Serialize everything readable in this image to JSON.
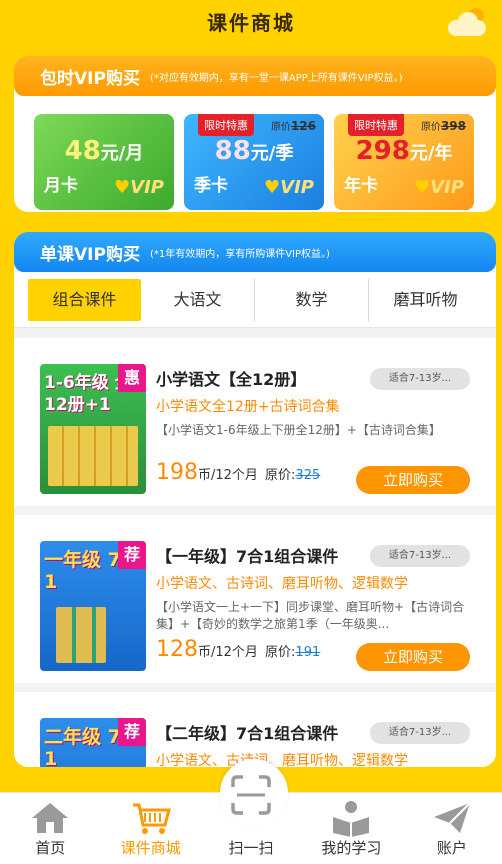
{
  "header": {
    "title": "课件商城"
  },
  "vip": {
    "title": "包时VIP购买",
    "note": "(*对应有效期内，享有一堂一课APP上所有课件VIP权益。)",
    "cards": [
      {
        "price": "48",
        "unit": "元/月",
        "kind": "月卡",
        "tag": "",
        "orig_label": "",
        "orig": ""
      },
      {
        "price": "88",
        "unit": "元/季",
        "kind": "季卡",
        "tag": "限时特惠",
        "orig_label": "原价",
        "orig": "126"
      },
      {
        "price": "298",
        "unit": "元/年",
        "kind": "年卡",
        "tag": "限时特惠",
        "orig_label": "原价",
        "orig": "398"
      }
    ],
    "vip_word": "VIP"
  },
  "single": {
    "title": "单课VIP购买",
    "note": "(*1年有效期内，享有所购课件VIP权益。)"
  },
  "tabs": [
    "组合课件",
    "大语文",
    "数学",
    "磨耳听物"
  ],
  "courses": [
    {
      "cover_text": "1-6年级 全12册+1",
      "badge": "惠",
      "title": "小学语文【全12册】",
      "age": "适合7-13岁...",
      "subtitle": "小学语文全12册+古诗词合集",
      "desc": "【小学语文1-6年级上下册全12册】+【古诗词合集】",
      "price": "198",
      "unit": "币/12个月",
      "orig_label": "原价:",
      "orig": "325",
      "buy": "立即购买"
    },
    {
      "cover_text": "一年级 7合1",
      "badge": "荐",
      "title": "【一年级】7合1组合课件",
      "age": "适合7-13岁...",
      "subtitle": "小学语文、古诗词、磨耳听物、逻辑数学",
      "desc": "【小学语文一上+一下】同步课堂、磨耳听物+【古诗词合集】+【奇妙的数学之旅第1季（一年级奥...",
      "price": "128",
      "unit": "币/12个月",
      "orig_label": "原价:",
      "orig": "191",
      "buy": "立即购买"
    },
    {
      "cover_text": "二年级 7合1",
      "badge": "荐",
      "title": "【二年级】7合1组合课件",
      "age": "适合7-13岁...",
      "subtitle": "小学语文、古诗词、磨耳听物、逻辑数学"
    }
  ],
  "tabbar": [
    {
      "label": "首页",
      "icon": "home-icon"
    },
    {
      "label": "课件商城",
      "icon": "cart-icon"
    },
    {
      "label": "扫一扫",
      "icon": "scan-icon"
    },
    {
      "label": "我的学习",
      "icon": "reading-icon"
    },
    {
      "label": "账户",
      "icon": "paper-plane-icon"
    }
  ],
  "colors": {
    "accent": "#FF9A00",
    "background": "#FFD200",
    "blue": "#1387EE"
  }
}
